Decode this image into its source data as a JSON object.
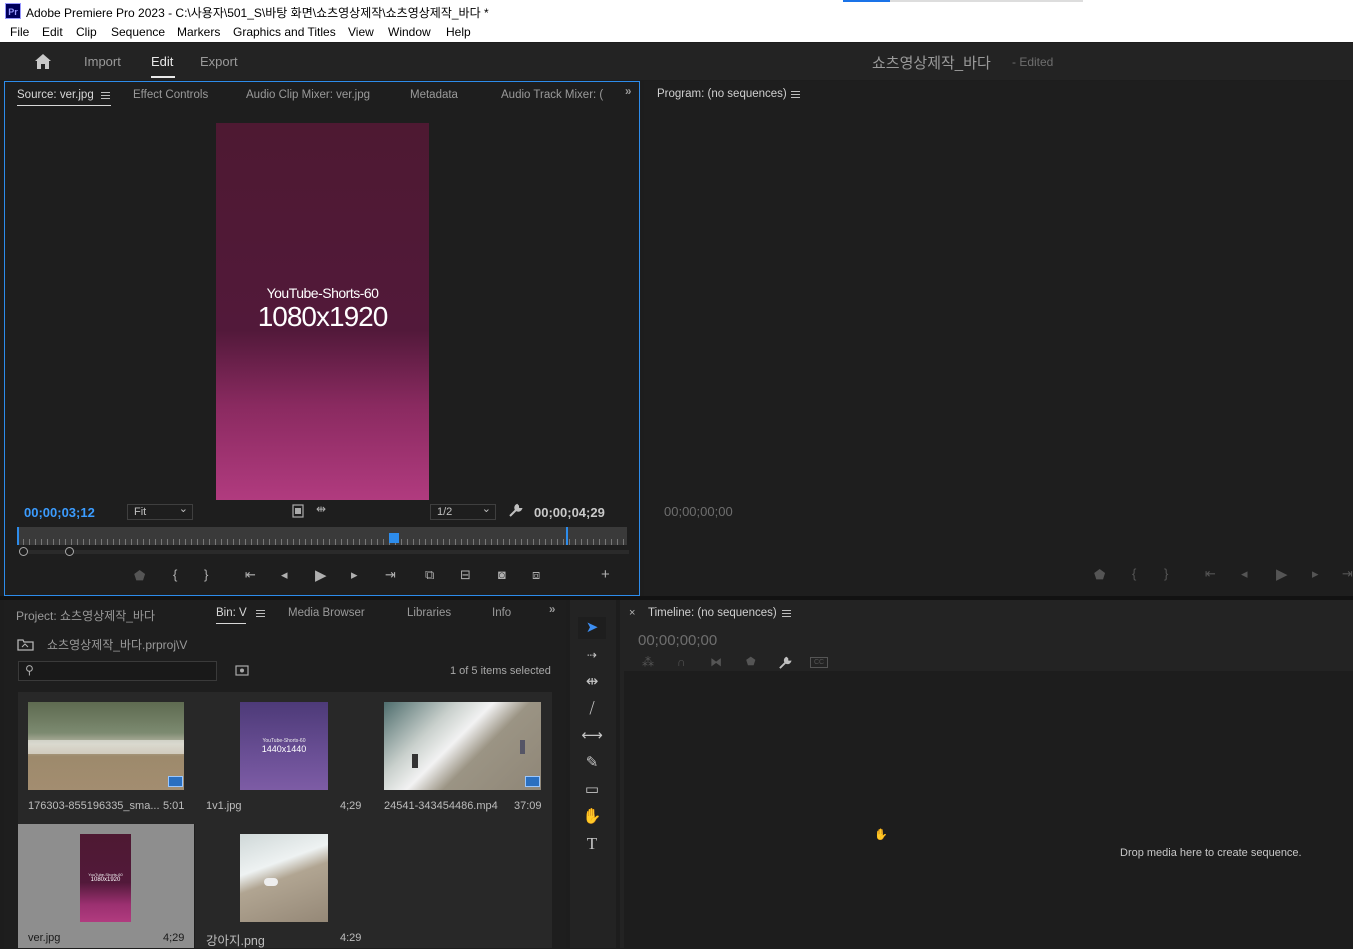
{
  "window": {
    "app_icon": "Pr",
    "title": "Adobe Premiere Pro 2023 - C:\\사용자\\501_S\\바탕 화면\\쇼츠영상제작\\쇼츠영상제작_바다 *"
  },
  "menu": [
    "File",
    "Edit",
    "Clip",
    "Sequence",
    "Markers",
    "Graphics and Titles",
    "View",
    "Window",
    "Help"
  ],
  "header": {
    "tabs": [
      "Import",
      "Edit",
      "Export"
    ],
    "active_tab": "Edit",
    "project_title": "쇼츠영상제작_바다",
    "project_status": "- Edited"
  },
  "source": {
    "tabs": [
      "Source: ver.jpg",
      "Effect Controls",
      "Audio Clip Mixer: ver.jpg",
      "Metadata",
      "Audio Track Mixer: ("
    ],
    "preview_line1": "YouTube-Shorts-60",
    "preview_line2": "1080x1920",
    "timecode_current": "00;00;03;12",
    "zoom": "Fit",
    "resolution": "1/2",
    "timecode_duration": "00;00;04;29",
    "playhead_fraction": 0.68
  },
  "program": {
    "title": "Program: (no sequences)",
    "timecode": "00;00;00;00"
  },
  "project": {
    "tabs": [
      "Project: 쇼츠영상제작_바다",
      "Bin: V",
      "Media Browser",
      "Libraries",
      "Info"
    ],
    "path": "쇼츠영상제작_바다.prproj\\V",
    "selection_status": "1 of 5 items selected",
    "items": [
      {
        "name": "176303-855196335_sma...",
        "duration": "5:01",
        "type": "video"
      },
      {
        "name": "1v1.jpg",
        "duration": "4;29",
        "type": "image",
        "overlay1": "YouTube-Shorts-60",
        "overlay2": "1440x1440"
      },
      {
        "name": "24541-343454486.mp4",
        "duration": "37:09",
        "type": "video"
      },
      {
        "name": "ver.jpg",
        "duration": "4;29",
        "type": "image",
        "overlay1": "YouTube-Shorts-60",
        "overlay2": "1080x1920"
      },
      {
        "name": "강아지.png",
        "duration": "4:29",
        "type": "image"
      }
    ]
  },
  "timeline": {
    "title": "Timeline: (no sequences)",
    "timecode": "00;00;00;00",
    "drop_hint": "Drop media here to create sequence."
  },
  "colors": {
    "accent": "#2d8ceb",
    "timecode_blue": "#3b9cff",
    "panel_bg": "#1e1e1e"
  }
}
